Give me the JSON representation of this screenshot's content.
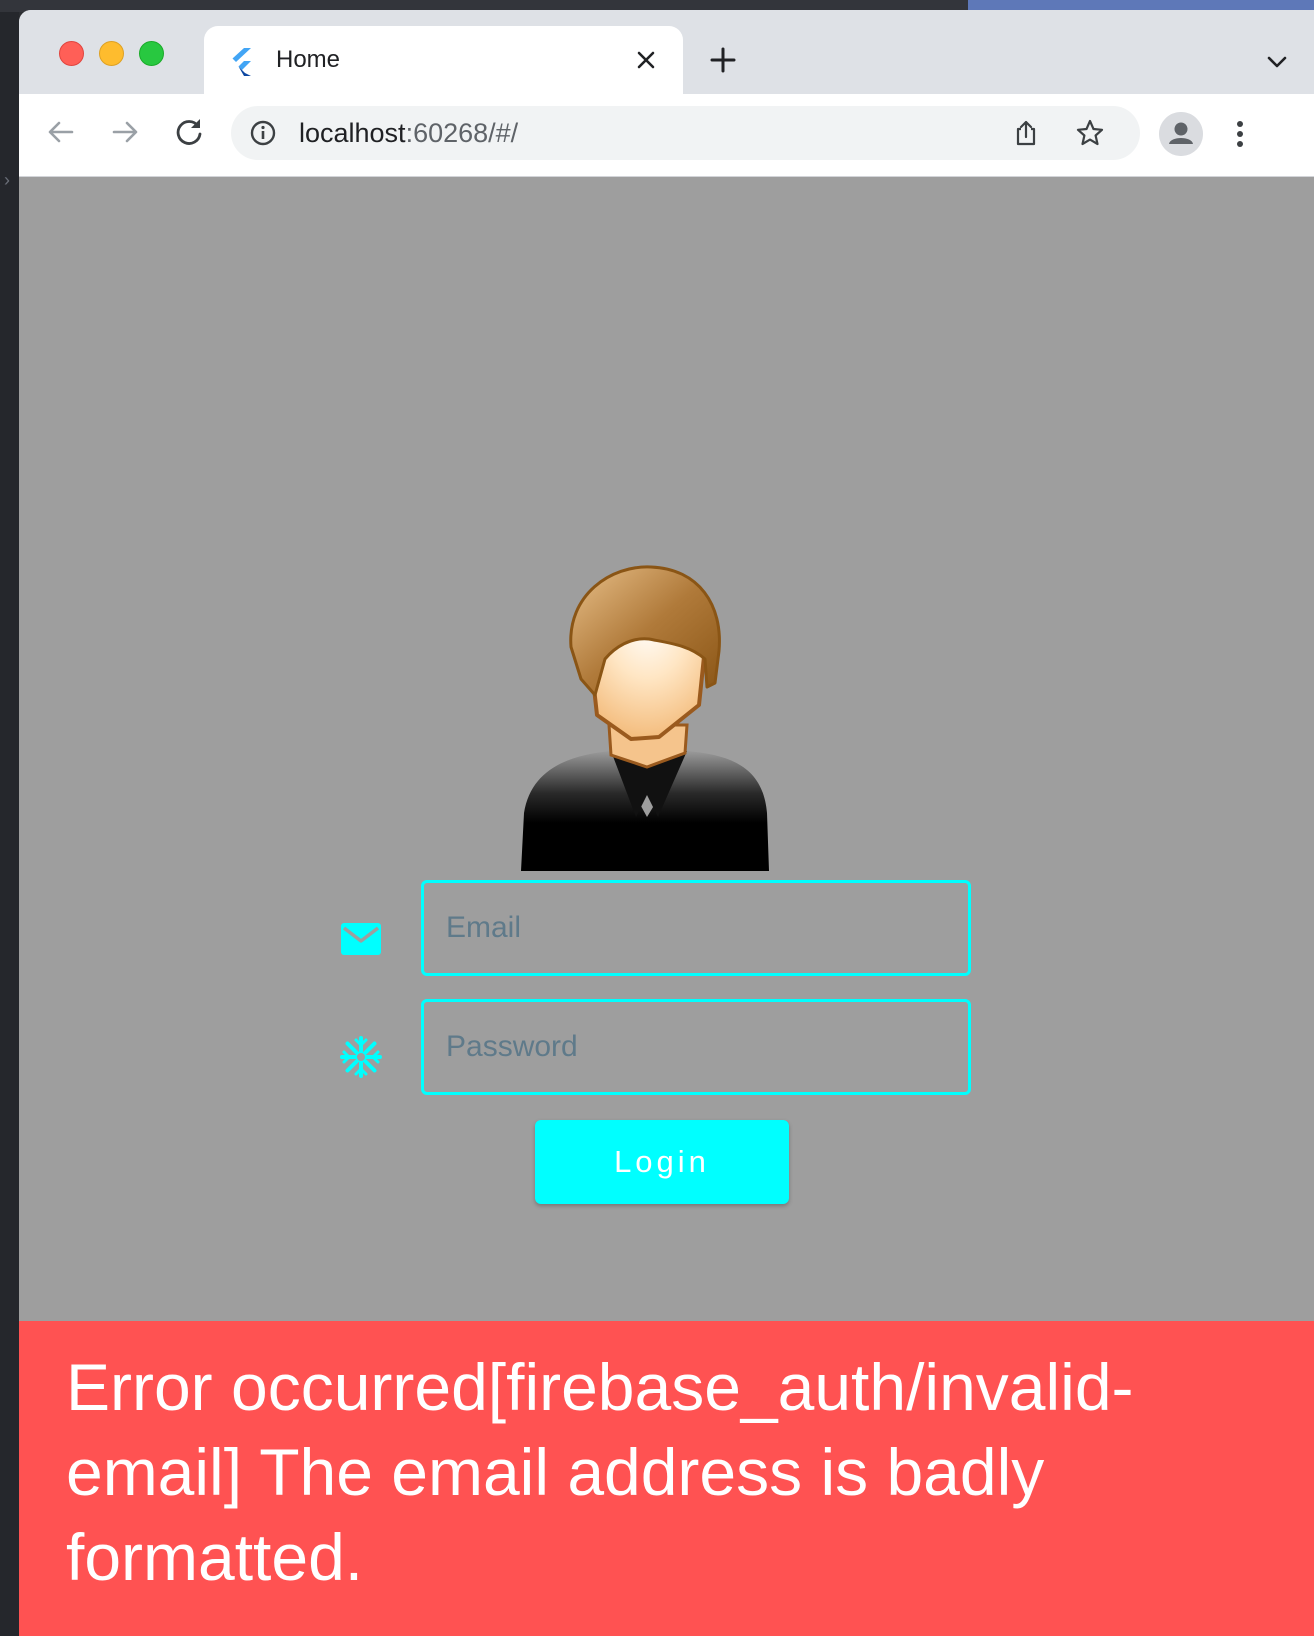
{
  "browser": {
    "tab": {
      "title": "Home"
    },
    "address_bar": {
      "host": "localhost",
      "port_path": ":60268/#/"
    }
  },
  "login_form": {
    "email": {
      "placeholder": "Email",
      "value": ""
    },
    "password": {
      "placeholder": "Password",
      "value": ""
    },
    "login_label": "Login"
  },
  "snackbar": {
    "message": "Error occurred[firebase_auth/invalid-email] The email address is badly formatted."
  },
  "colors": {
    "accent": "#00ffff",
    "error_background": "#ff5252",
    "page_background": "#9e9e9e"
  },
  "icons": {
    "email_field": "mail-icon",
    "password_field": "asterisk-icon"
  }
}
